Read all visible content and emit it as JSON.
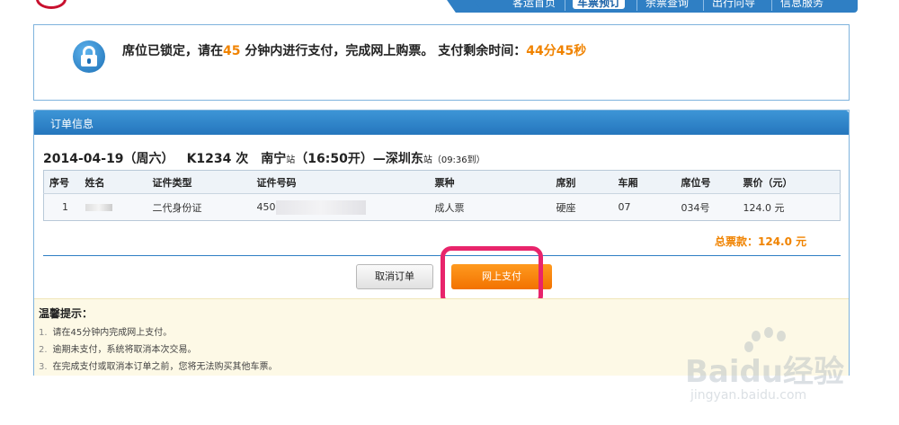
{
  "nav": {
    "items": [
      "客运首页",
      "车票预订",
      "余票查询",
      "出行向导",
      "信息服务"
    ],
    "active_index": 1
  },
  "lock": {
    "prefix": "席位已锁定，请在",
    "minutes": "45",
    "middle": " 分钟内进行支付，完成网上购票。 支付剩余时间：",
    "countdown": "44分45秒"
  },
  "panel": {
    "title": "订单信息"
  },
  "trip": {
    "date": "2014-04-19（周六）",
    "train": "K1234 次",
    "from_station": "南宁",
    "from_suffix": "站",
    "depart": "（16:50开）—",
    "to_station": "深圳东",
    "to_suffix": "站",
    "arrive": "（09:36到）"
  },
  "table": {
    "headers": [
      "序号",
      "姓名",
      "证件类型",
      "证件号码",
      "票种",
      "席别",
      "车厢",
      "席位号",
      "票价（元）"
    ],
    "rows": [
      {
        "index": "1",
        "name": "",
        "id_type": "二代身份证",
        "id_number": "450",
        "ticket_type": "成人票",
        "seat_class": "硬座",
        "car": "07",
        "seat_no": "034号",
        "price": "124.0 元"
      }
    ]
  },
  "total": "总票款：124.0 元",
  "buttons": {
    "cancel": "取消订单",
    "pay": "网上支付"
  },
  "tips": {
    "title": "温馨提示：",
    "items": [
      "请在45分钟内完成网上支付。",
      "逾期未支付，系统将取消本次交易。",
      "在完成支付或取消本订单之前，您将无法购买其他车票。"
    ],
    "numbers": [
      "1.",
      "2.",
      "3."
    ]
  },
  "watermark": {
    "text": "Baidu经验",
    "url": "jingyan.baidu.com"
  },
  "colors": {
    "accent": "#2f7fc4",
    "orange": "#f08300",
    "highlight": "#e8246b"
  }
}
